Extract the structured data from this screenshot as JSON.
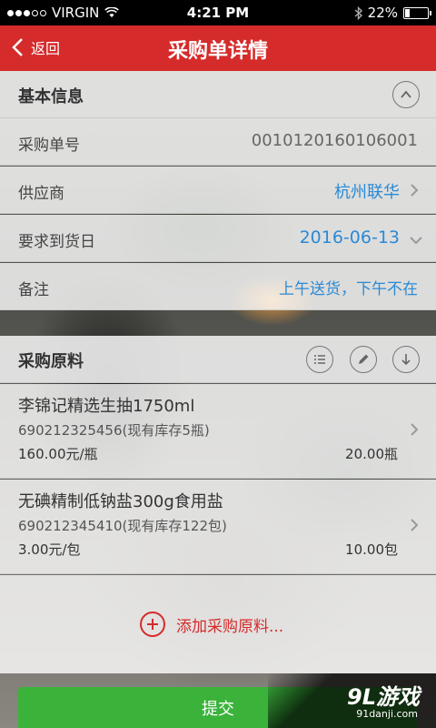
{
  "status_bar": {
    "carrier": "VIRGIN",
    "time": "4:21 PM",
    "battery": "22%",
    "battery_level": 0.22
  },
  "nav": {
    "back_label": "返回",
    "title": "采购单详情"
  },
  "basic_info": {
    "title": "基本信息",
    "rows": [
      {
        "label": "采购单号",
        "value": "0010120160106001"
      },
      {
        "label": "供应商",
        "value": "杭州联华"
      },
      {
        "label": "要求到货日",
        "value": "2016-06-13"
      },
      {
        "label": "备注",
        "value": "上午送货，下午不在"
      }
    ]
  },
  "materials": {
    "title": "采购原料",
    "items": [
      {
        "name": "李锦记精选生抽1750ml",
        "code": "690212325456(现有库存5瓶)",
        "price": "160.00元/瓶",
        "qty": "20.00瓶"
      },
      {
        "name": "无碘精制低钠盐300g食用盐",
        "code": "690212345410(现有库存122包)",
        "price": "3.00元/包",
        "qty": "10.00包"
      }
    ],
    "add_label": "添加采购原料..."
  },
  "submit_label": "提交",
  "watermark": {
    "logo": "9L游戏",
    "url": "91danji.com"
  },
  "colors": {
    "brand_red": "#d52b2b",
    "link_blue": "#2a8ad6",
    "submit_green": "#3bb33b"
  }
}
